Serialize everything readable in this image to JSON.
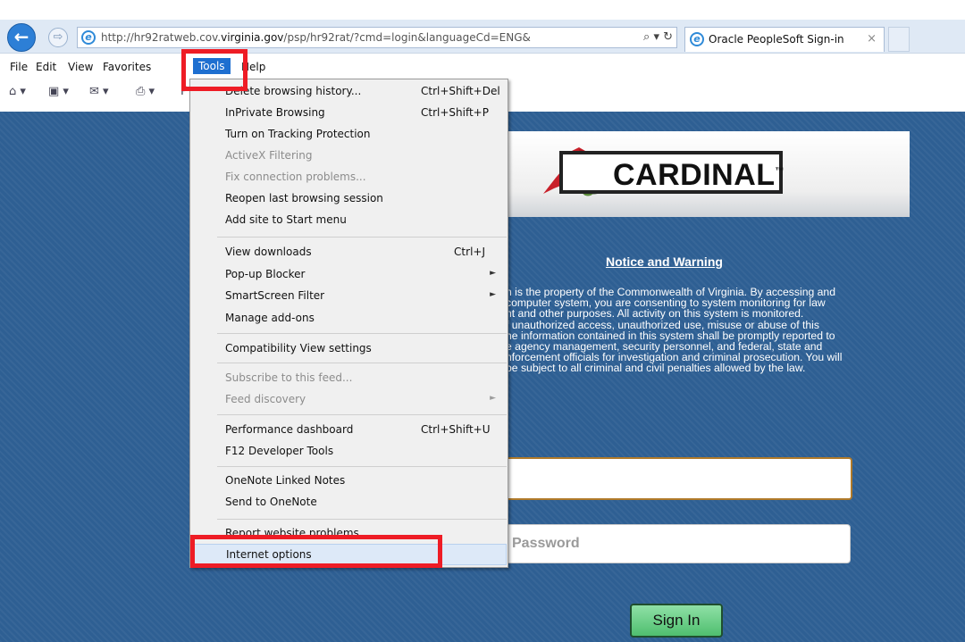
{
  "browser": {
    "url_prefix": "http://hr92ratweb.cov.",
    "url_domain": "virginia.gov",
    "url_suffix": "/psp/hr92rat/?cmd=login&languageCd=ENG&",
    "url_tools": "⌕ ▾ ↻",
    "tab_title": "Oracle PeopleSoft Sign-in",
    "tab_close": "×",
    "back_glyph": "←",
    "forward_glyph": "⇨"
  },
  "menubar": {
    "file": "File",
    "edit": "Edit",
    "view": "View",
    "favorites": "Favorites",
    "tools": "Tools",
    "help": "Help"
  },
  "toolbar": {
    "home": "⌂ ▾",
    "feeds": "▣ ▾",
    "mail": "✉ ▾",
    "print": "⎙ ▾",
    "page": "P"
  },
  "tools_menu": {
    "items": [
      {
        "label": "Delete browsing history...",
        "shortcut": "Ctrl+Shift+Del"
      },
      {
        "label": "InPrivate Browsing",
        "shortcut": "Ctrl+Shift+P"
      },
      {
        "label": "Turn on Tracking Protection",
        "shortcut": ""
      },
      {
        "label": "ActiveX Filtering",
        "shortcut": ""
      },
      {
        "label": "Fix connection problems...",
        "shortcut": ""
      },
      {
        "label": "Reopen last browsing session",
        "shortcut": ""
      },
      {
        "label": "Add site to Start menu",
        "shortcut": ""
      },
      {
        "label": "View downloads",
        "shortcut": "Ctrl+J"
      },
      {
        "label": "Pop-up Blocker",
        "shortcut": ""
      },
      {
        "label": "SmartScreen Filter",
        "shortcut": ""
      },
      {
        "label": "Manage add-ons",
        "shortcut": ""
      },
      {
        "label": "Compatibility View settings",
        "shortcut": ""
      },
      {
        "label": "Subscribe to this feed...",
        "shortcut": ""
      },
      {
        "label": "Feed discovery",
        "shortcut": ""
      },
      {
        "label": "Performance dashboard",
        "shortcut": "Ctrl+Shift+U"
      },
      {
        "label": "F12 Developer Tools",
        "shortcut": ""
      },
      {
        "label": "OneNote Linked Notes",
        "shortcut": ""
      },
      {
        "label": "Send to OneNote",
        "shortcut": ""
      },
      {
        "label": "Report website problems",
        "shortcut": ""
      },
      {
        "label": "Internet options",
        "shortcut": ""
      }
    ],
    "submenu_arrow": "►"
  },
  "page": {
    "logo_text": "CARDINAL",
    "logo_tm": "™",
    "notice_title": "Notice and Warning",
    "notice_body": "n is the property of the Commonwealth of Virginia. By accessing and\ncomputer system, you are consenting to system monitoring for law\nnt and other purposes. All activity on this system is monitored.\nf unauthorized access, unauthorized use, misuse or abuse of this\nhe information contained in this system shall be promptly reported to\ne agency management, security personnel, and federal, state and\nnforcement officials for investigation and criminal prosecution. You will\nbe subject to all criminal and civil penalties allowed by the law.",
    "user_value": "",
    "password_placeholder": "Password",
    "signin_label": "Sign In"
  },
  "colors": {
    "page_bg": "#2e5f93",
    "highlight": "#ee1c25",
    "menu_active": "#1e6fd0",
    "signin_green": "#4fbf6f"
  }
}
